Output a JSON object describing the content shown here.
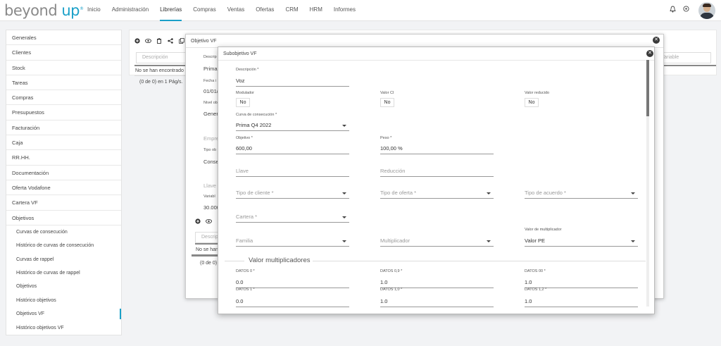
{
  "logo": {
    "main": "beyond",
    "accent": "up"
  },
  "nav": [
    "Inicio",
    "Administración",
    "Librerías",
    "Compras",
    "Ventas",
    "Ofertas",
    "CRM",
    "HRM",
    "Informes"
  ],
  "nav_active": "Librerías",
  "top_icons": {
    "bell": "🔔",
    "settings": "⊕"
  },
  "sidebar": {
    "items": [
      "Generales",
      "Clientes",
      "Stock",
      "Tareas",
      "Compras",
      "Presupuestos",
      "Facturación",
      "Caja",
      "RR.HH.",
      "Documentación",
      "Oferta Vodafone",
      "Cartera VF",
      "Objetivos"
    ],
    "subitems": [
      "Curvas de consecución",
      "Histórico de curvas de consecución",
      "Curvas de rappel",
      "Histórico de curvas de rappel",
      "Objetivos",
      "Histórico objetivos",
      "Objetivos VF",
      "Histórico objetivos VF"
    ],
    "active": "Objetivos VF"
  },
  "background": {
    "search_placeholder": "Descripción",
    "search_right_placeholder": "Variable",
    "empty_message": "No se han encontrado",
    "paging": "(0 de 0) en 1 Pág/s.",
    "empty_message_2": "No se han",
    "paging_2": "(0 de 0)"
  },
  "modal1": {
    "title": "Objetivo VF",
    "labels": {
      "desc": "Descrip",
      "fecha": "Fecha i",
      "nivel": "Nivel ob",
      "tipo": "Tipo ob",
      "variable": "Variabl"
    },
    "values": {
      "prima": "Prima",
      "fecha": "01/01/",
      "nivel": "Gener",
      "tipo": "Conse",
      "variable": "30.000"
    },
    "placeholders": {
      "empresa": "Empre",
      "llave": "Llave p",
      "search": "Descrip"
    }
  },
  "modal2": {
    "title": "Subobjetivo VF",
    "descripcion": {
      "label": "Descripción *",
      "value": "Voz"
    },
    "modulador": {
      "label": "Modulador",
      "value": "No"
    },
    "valor_ci": {
      "label": "Valor CI",
      "value": "No"
    },
    "valor_reducido": {
      "label": "Valor reducido",
      "value": "No"
    },
    "curva": {
      "label": "Curva de consecución *",
      "value": "Prima Q4 2022"
    },
    "objetivo": {
      "label": "Objetivo *",
      "value": "600,00"
    },
    "peso": {
      "label": "Peso *",
      "value": "100,00 %"
    },
    "llave": "Llave",
    "reduccion": "Reducción",
    "tipo_cliente": "Tipo de cliente *",
    "tipo_oferta": "Tipo de oferta *",
    "tipo_acuerdo": "Tipo de acuerdo *",
    "cartera": "Cartera *",
    "familia": "Familia",
    "multiplicador": "Multiplicador",
    "valor_multiplicador": {
      "label": "Valor de multiplicador",
      "value": "Valor PE"
    },
    "section_title": "Valor multiplicadores",
    "datos": [
      {
        "label": "DATOS 0 *",
        "value": "0.0"
      },
      {
        "label": "DATOS 0,9 *",
        "value": "1.0"
      },
      {
        "label": "DATOS 00 *",
        "value": "1.0"
      },
      {
        "label": "DATOS 1 *",
        "value": "0.0"
      },
      {
        "label": "DATOS 1,0 *",
        "value": "1.0"
      },
      {
        "label": "DATOS 1,2 *",
        "value": "1.0"
      }
    ]
  }
}
